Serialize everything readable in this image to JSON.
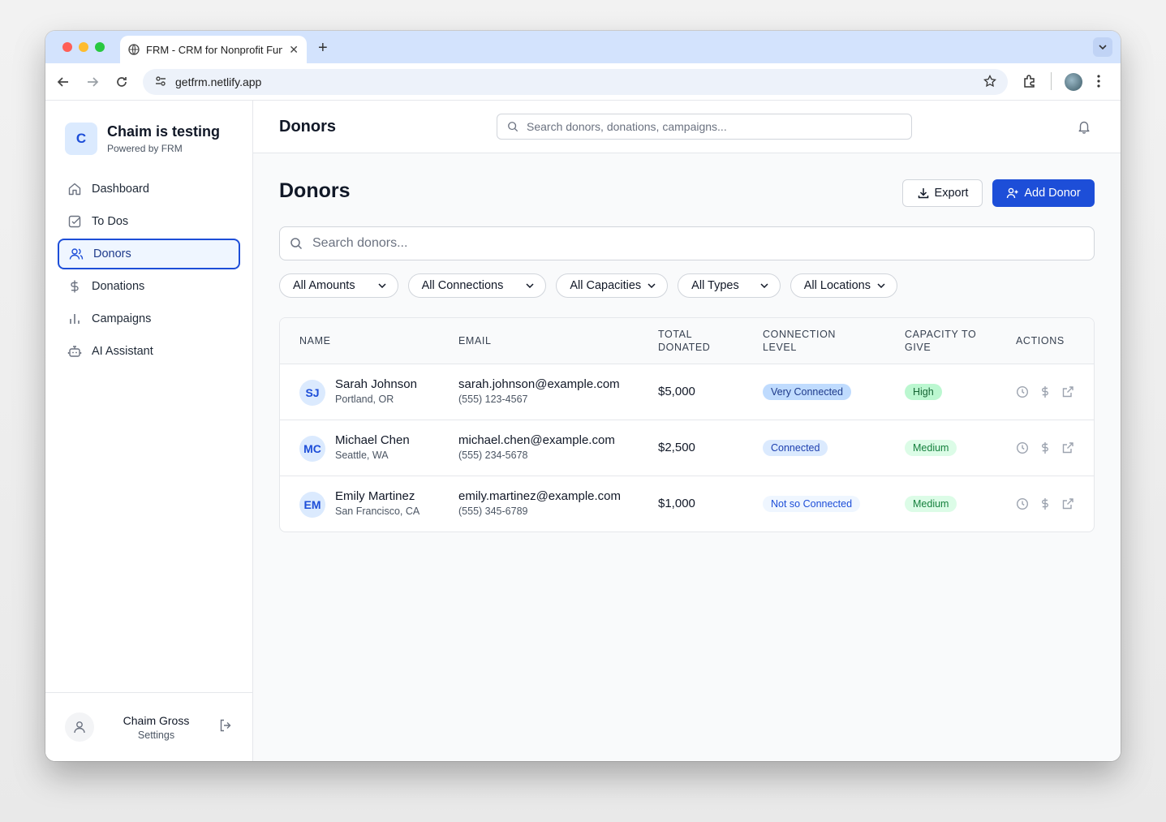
{
  "browser": {
    "tab_title": "FRM - CRM for Nonprofit Fundraising",
    "url": "getfrm.netlify.app"
  },
  "sidebar": {
    "brand_initial": "C",
    "brand_name": "Chaim is testing",
    "brand_sub": "Powered by FRM",
    "items": [
      {
        "label": "Dashboard",
        "icon": "home-icon"
      },
      {
        "label": "To Dos",
        "icon": "checkbox-icon"
      },
      {
        "label": "Donors",
        "icon": "users-icon",
        "active": true
      },
      {
        "label": "Donations",
        "icon": "dollar-icon"
      },
      {
        "label": "Campaigns",
        "icon": "bar-chart-icon"
      },
      {
        "label": "AI Assistant",
        "icon": "bot-icon"
      }
    ],
    "user_name": "Chaim Gross",
    "user_settings": "Settings"
  },
  "header": {
    "title": "Donors",
    "search_placeholder": "Search donors, donations, campaigns..."
  },
  "page": {
    "title": "Donors",
    "export_label": "Export",
    "add_label": "Add Donor",
    "search_placeholder": "Search donors...",
    "filters": [
      "All Amounts",
      "All Connections",
      "All Capacities",
      "All Types",
      "All Locations"
    ]
  },
  "table": {
    "columns": [
      "Name",
      "Email",
      "Total Donated",
      "Connection Level",
      "Capacity to Give",
      "Actions"
    ],
    "rows": [
      {
        "initials": "SJ",
        "name": "Sarah Johnson",
        "location": "Portland, OR",
        "email": "sarah.johnson@example.com",
        "phone": "(555) 123-4567",
        "total": "$5,000",
        "connection": "Very Connected",
        "capacity": "High"
      },
      {
        "initials": "MC",
        "name": "Michael Chen",
        "location": "Seattle, WA",
        "email": "michael.chen@example.com",
        "phone": "(555) 234-5678",
        "total": "$2,500",
        "connection": "Connected",
        "capacity": "Medium"
      },
      {
        "initials": "EM",
        "name": "Emily Martinez",
        "location": "San Francisco, CA",
        "email": "emily.martinez@example.com",
        "phone": "(555) 345-6789",
        "total": "$1,000",
        "connection": "Not so Connected",
        "capacity": "Medium"
      }
    ]
  },
  "colors": {
    "accent": "#1d4ed8",
    "active_nav_bg": "#eff6ff"
  }
}
